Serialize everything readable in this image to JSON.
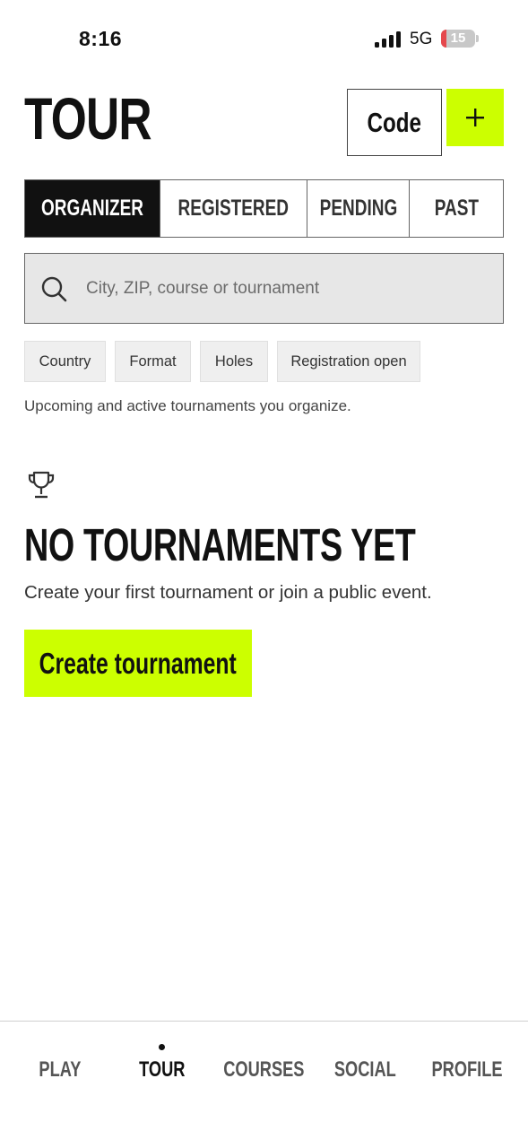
{
  "status_bar": {
    "time": "8:16",
    "network": "5G",
    "battery_level": "15",
    "battery_fill_fraction": 0.15,
    "battery_color": "#e5484d"
  },
  "header": {
    "title": "TOUR",
    "code_label": "Code",
    "add_icon": "plus-icon"
  },
  "tabs": [
    {
      "label": "ORGANIZER",
      "active": true
    },
    {
      "label": "REGISTERED",
      "active": false
    },
    {
      "label": "PENDING",
      "active": false
    },
    {
      "label": "PAST",
      "active": false
    }
  ],
  "search": {
    "icon": "search-icon",
    "placeholder": "City, ZIP, course or tournament",
    "value": ""
  },
  "filters": [
    {
      "label": "Country"
    },
    {
      "label": "Format"
    },
    {
      "label": "Holes"
    },
    {
      "label": "Registration open"
    }
  ],
  "subtitle": "Upcoming and active tournaments you organize.",
  "empty_state": {
    "icon": "trophy-icon",
    "title": "NO TOURNAMENTS YET",
    "text": "Create your first tournament or join a public event.",
    "button_label": "Create tournament"
  },
  "bottom_nav": [
    {
      "label": "PLAY",
      "active": false
    },
    {
      "label": "TOUR",
      "active": true
    },
    {
      "label": "COURSES",
      "active": false
    },
    {
      "label": "SOCIAL",
      "active": false
    },
    {
      "label": "PROFILE",
      "active": false
    }
  ],
  "colors": {
    "accent": "#ccff00",
    "active_tab_bg": "#111111",
    "search_bg": "#e7e7e7"
  }
}
